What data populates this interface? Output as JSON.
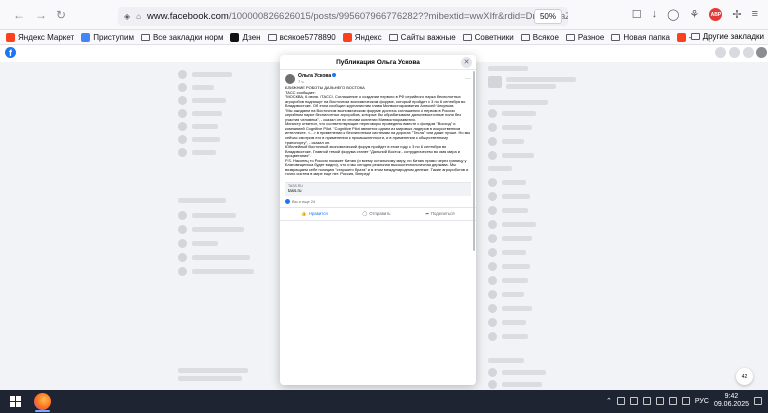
{
  "browser": {
    "url_host": "www.facebook.com",
    "url_path": "/100000826626015/posts/995607966776282??mibextid=wwXIfr&rdid=DrIGHvtaZZ5X...",
    "zoom": "50%",
    "bookmarks": [
      {
        "label": "Яндекс Маркет",
        "color": "#fc3f1d",
        "type": "icon"
      },
      {
        "label": "Приступим",
        "color": "#4285f4",
        "type": "icon"
      },
      {
        "label": "Все закладки норм",
        "color": "",
        "type": "folder"
      },
      {
        "label": "Дзен",
        "color": "#111111",
        "type": "icon"
      },
      {
        "label": "всякое5778890",
        "color": "",
        "type": "folder"
      },
      {
        "label": "Яндекс",
        "color": "#fc3f1d",
        "type": "icon"
      },
      {
        "label": "Сайты важные",
        "color": "",
        "type": "folder"
      },
      {
        "label": "Советники",
        "color": "",
        "type": "folder"
      },
      {
        "label": "Всякое",
        "color": "",
        "type": "folder"
      },
      {
        "label": "Разное",
        "color": "",
        "type": "folder"
      },
      {
        "label": "Новая папка",
        "color": "",
        "type": "folder"
      },
      {
        "label": "— Яндекс: нашло...",
        "color": "#fc3f1d",
        "type": "icon"
      }
    ],
    "bookmarks_other": "Другие закладки"
  },
  "modal": {
    "title": "Публикация Ольга Ускова",
    "author": "Ольга Ускова",
    "date": "7 ч.",
    "paragraphs": [
      "БЛИЖНИЕ РОБОТЫ ДАЛЬНЕГО ВОСТОКА",
      "ТАСС сообщает:",
      "\"МОСКВА, 6 июня. /ТАСС/. Соглашение о создании первого в РФ серийного парка беспилотных агроробов подпишут на Восточном экономическом форуме, который пройдет с 3 по 6 сентября во Владивостоке. Об этом сообщил журналистам глава Минвостокразвития Алексей Чекунков.",
      "\"Мы ожидаем на Восточном экономическом форуме достичь соглашения о первом в России серийном парке беспилотных агроробов, которые бы обрабатывали дальневосточные поля без участия человека\", - сказал он по итогам коллегии Минвостокразвития.",
      "Министр отметил, что соответствующие переговоры проведены вместе с фондом \"Восход\" и компанией Cognitive Pilot. \"Cognitive Pilot является одним из мировых лидеров в искусственном интеллекте. <...> в применении к беспилотным системам на дорогах \"Тесла\" или даже лучше. Но мы сейчас смотрим его в применении к промышленности, и в применении к общественному транспорту\", - сказал он.",
      "Юбилейный Восточный экономический форум пройдет в этом году с 3 по 6 сентября во Владивостоке. Главной темой форума станет \"Дальний Восток - сотрудничество во имя мира и процветания\".",
      "P.S. Наконец то Россия покажет Китаю (и всему остальному миру, но Китаю прямо через границу у Благовещенска будет видно), что и мы сегодня реальная высокотехнологичная держава. Мы возвращаем себе позицию \"старшего брата\" и в этом международном дележе. Такие агророботов и точно систем в мире еще нет. Россия, Вперед!"
    ],
    "link_domain": "TASS.RU",
    "link_title": "tass.ru",
    "reactions": "Вы и еще 24",
    "actions": {
      "like": "Нравится",
      "comment": "Отправить",
      "share": "Поделиться"
    }
  },
  "taskbar": {
    "language": "РУС",
    "time": "9:42",
    "date": "09.06.2025",
    "notif_count": "42"
  }
}
